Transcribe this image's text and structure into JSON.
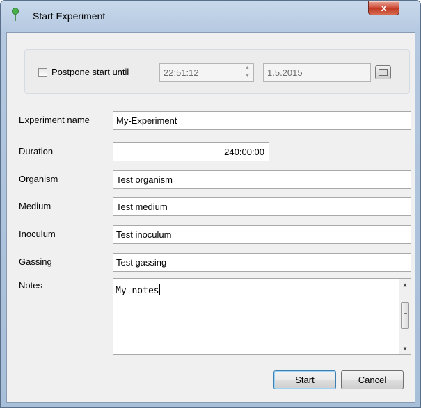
{
  "window": {
    "title": "Start Experiment",
    "close_glyph": "x"
  },
  "postpone": {
    "checked": false,
    "label": "Postpone start until",
    "time": "22:51:12",
    "date": "1.5.2015"
  },
  "form": {
    "experiment_name": {
      "label": "Experiment name",
      "value": "My-Experiment"
    },
    "duration": {
      "label": "Duration",
      "value": "240:00:00"
    },
    "organism": {
      "label": "Organism",
      "value": "Test organism"
    },
    "medium": {
      "label": "Medium",
      "value": "Test medium"
    },
    "inoculum": {
      "label": "Inoculum",
      "value": "Test inoculum"
    },
    "gassing": {
      "label": "Gassing",
      "value": "Test gassing"
    },
    "notes": {
      "label": "Notes",
      "value": "My notes"
    }
  },
  "buttons": {
    "start": "Start",
    "cancel": "Cancel"
  }
}
